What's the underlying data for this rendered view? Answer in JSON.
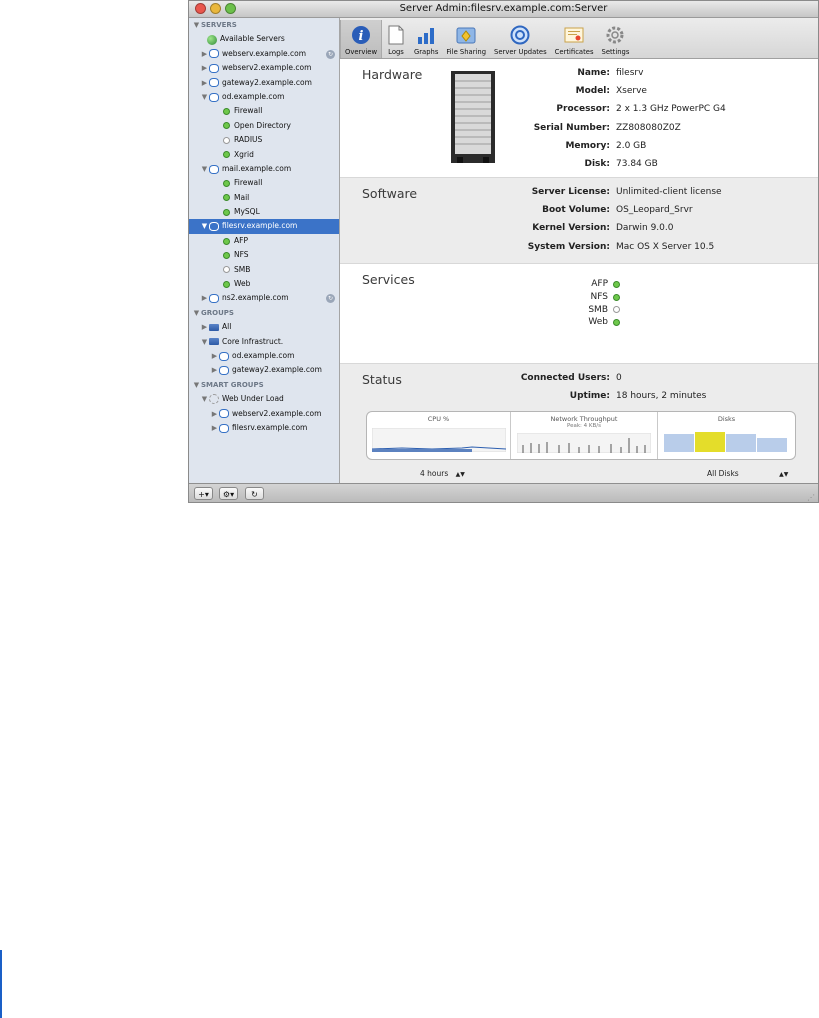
{
  "window": {
    "title": "Server Admin:filesrv.example.com:Server"
  },
  "sidebar": {
    "servers_header": "SERVERS",
    "available_servers": "Available Servers",
    "servers": [
      {
        "name": "webserv.example.com",
        "expanded": false
      },
      {
        "name": "webserv2.example.com",
        "expanded": false
      },
      {
        "name": "gateway2.example.com",
        "expanded": false
      },
      {
        "name": "od.example.com",
        "expanded": true,
        "services": [
          {
            "name": "Firewall",
            "status": "running"
          },
          {
            "name": "Open Directory",
            "status": "running"
          },
          {
            "name": "RADIUS",
            "status": "stopped"
          },
          {
            "name": "Xgrid",
            "status": "running"
          }
        ]
      },
      {
        "name": "mail.example.com",
        "expanded": true,
        "services": [
          {
            "name": "Firewall",
            "status": "running"
          },
          {
            "name": "Mail",
            "status": "running"
          },
          {
            "name": "MySQL",
            "status": "running"
          }
        ]
      },
      {
        "name": "filesrv.example.com",
        "expanded": true,
        "selected": true,
        "services": [
          {
            "name": "AFP",
            "status": "running"
          },
          {
            "name": "NFS",
            "status": "running"
          },
          {
            "name": "SMB",
            "status": "stopped"
          },
          {
            "name": "Web",
            "status": "running"
          }
        ]
      },
      {
        "name": "ns2.example.com",
        "expanded": false
      }
    ],
    "groups_header": "GROUPS",
    "groups": [
      {
        "name": "All"
      },
      {
        "name": "Core Infrastruct.",
        "members": [
          "od.example.com",
          "gateway2.example.com"
        ]
      }
    ],
    "smart_groups_header": "SMART GROUPS",
    "smart_group": {
      "name": "Web Under Load",
      "members": [
        "webserv2.example.com",
        "filesrv.example.com"
      ]
    }
  },
  "toolbar": {
    "buttons": [
      {
        "label": "Overview",
        "icon": "info-icon",
        "active": true
      },
      {
        "label": "Logs",
        "icon": "logs-icon"
      },
      {
        "label": "Graphs",
        "icon": "graphs-icon"
      },
      {
        "label": "File Sharing",
        "icon": "file-sharing-icon"
      },
      {
        "label": "Server Updates",
        "icon": "server-updates-icon"
      },
      {
        "label": "Certificates",
        "icon": "certificates-icon"
      },
      {
        "label": "Settings",
        "icon": "gear-icon"
      }
    ]
  },
  "hardware": {
    "title": "Hardware",
    "rows": [
      {
        "key": "Name:",
        "value": "filesrv"
      },
      {
        "key": "Model:",
        "value": "Xserve"
      },
      {
        "key": "Processor:",
        "value": "2 x 1.3 GHz PowerPC G4"
      },
      {
        "key": "Serial Number:",
        "value": "ZZ808080Z0Z"
      },
      {
        "key": "Memory:",
        "value": "2.0 GB"
      },
      {
        "key": "Disk:",
        "value": "73.84 GB"
      }
    ]
  },
  "software": {
    "title": "Software",
    "rows": [
      {
        "key": "Server License:",
        "value": "Unlimited-client license"
      },
      {
        "key": "Boot Volume:",
        "value": "OS_Leopard_Srvr"
      },
      {
        "key": "Kernel Version:",
        "value": "Darwin 9.0.0"
      },
      {
        "key": "System Version:",
        "value": "Mac OS X Server 10.5"
      }
    ]
  },
  "services": {
    "title": "Services",
    "rows": [
      {
        "key": "AFP",
        "status": "running"
      },
      {
        "key": "NFS",
        "status": "running"
      },
      {
        "key": "SMB",
        "status": "stopped"
      },
      {
        "key": "Web",
        "status": "running"
      }
    ]
  },
  "status": {
    "title": "Status",
    "rows": [
      {
        "key": "Connected Users:",
        "value": "0"
      },
      {
        "key": "Uptime:",
        "value": "18 hours, 2 minutes"
      }
    ],
    "cpu_title": "CPU %",
    "network_title": "Network Throughput",
    "network_peak": "Peak: 4 KB/s",
    "disks_title": "Disks",
    "time_range": "4 hours",
    "disk_filter": "All Disks"
  },
  "colors": {
    "selection": "#3b73c8",
    "running": "#6ec84b",
    "stopped": "#ffffff"
  }
}
